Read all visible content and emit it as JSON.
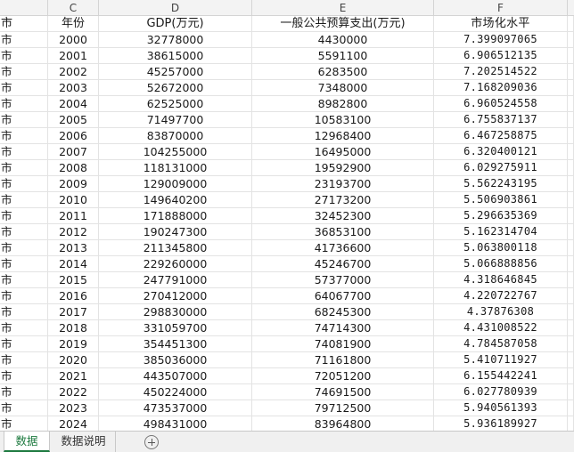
{
  "columns": {
    "c": "C",
    "d": "D",
    "e": "E",
    "f": "F"
  },
  "header": {
    "b": "市",
    "c": "年份",
    "d": "GDP(万元)",
    "e": "一般公共预算支出(万元)",
    "f": "市场化水平"
  },
  "rows": [
    {
      "b": "市",
      "c": "2000",
      "d": "32778000",
      "e": "4430000",
      "f": "7.399097065"
    },
    {
      "b": "市",
      "c": "2001",
      "d": "38615000",
      "e": "5591100",
      "f": "6.906512135"
    },
    {
      "b": "市",
      "c": "2002",
      "d": "45257000",
      "e": "6283500",
      "f": "7.202514522"
    },
    {
      "b": "市",
      "c": "2003",
      "d": "52672000",
      "e": "7348000",
      "f": "7.168209036"
    },
    {
      "b": "市",
      "c": "2004",
      "d": "62525000",
      "e": "8982800",
      "f": "6.960524558"
    },
    {
      "b": "市",
      "c": "2005",
      "d": "71497700",
      "e": "10583100",
      "f": "6.755837137"
    },
    {
      "b": "市",
      "c": "2006",
      "d": "83870000",
      "e": "12968400",
      "f": "6.467258875"
    },
    {
      "b": "市",
      "c": "2007",
      "d": "104255000",
      "e": "16495000",
      "f": "6.320400121"
    },
    {
      "b": "市",
      "c": "2008",
      "d": "118131000",
      "e": "19592900",
      "f": "6.029275911"
    },
    {
      "b": "市",
      "c": "2009",
      "d": "129009000",
      "e": "23193700",
      "f": "5.562243195"
    },
    {
      "b": "市",
      "c": "2010",
      "d": "149640200",
      "e": "27173200",
      "f": "5.506903861"
    },
    {
      "b": "市",
      "c": "2011",
      "d": "171888000",
      "e": "32452300",
      "f": "5.296635369"
    },
    {
      "b": "市",
      "c": "2012",
      "d": "190247300",
      "e": "36853100",
      "f": "5.162314704"
    },
    {
      "b": "市",
      "c": "2013",
      "d": "211345800",
      "e": "41736600",
      "f": "5.063800118"
    },
    {
      "b": "市",
      "c": "2014",
      "d": "229260000",
      "e": "45246700",
      "f": "5.066888856"
    },
    {
      "b": "市",
      "c": "2015",
      "d": "247791000",
      "e": "57377000",
      "f": "4.318646845"
    },
    {
      "b": "市",
      "c": "2016",
      "d": "270412000",
      "e": "64067700",
      "f": "4.220722767"
    },
    {
      "b": "市",
      "c": "2017",
      "d": "298830000",
      "e": "68245300",
      "f": "4.37876308"
    },
    {
      "b": "市",
      "c": "2018",
      "d": "331059700",
      "e": "74714300",
      "f": "4.431008522"
    },
    {
      "b": "市",
      "c": "2019",
      "d": "354451300",
      "e": "74081900",
      "f": "4.784587058"
    },
    {
      "b": "市",
      "c": "2020",
      "d": "385036000",
      "e": "71161800",
      "f": "5.410711927"
    },
    {
      "b": "市",
      "c": "2021",
      "d": "443507000",
      "e": "72051200",
      "f": "6.155442241"
    },
    {
      "b": "市",
      "c": "2022",
      "d": "450224000",
      "e": "74691500",
      "f": "6.027780939"
    },
    {
      "b": "市",
      "c": "2023",
      "d": "473537000",
      "e": "79712500",
      "f": "5.940561393"
    },
    {
      "b": "市",
      "c": "2024",
      "d": "498431000",
      "e": "83964800",
      "f": "5.936189927"
    }
  ],
  "tabs": {
    "active": "数据",
    "second": "数据说明"
  },
  "colors": {
    "active_tab": "#1d7a3f",
    "grid": "#e3e3e3",
    "header_bg": "#f3f3f3"
  },
  "icons": {
    "add_sheet": "plus-circle-icon"
  }
}
